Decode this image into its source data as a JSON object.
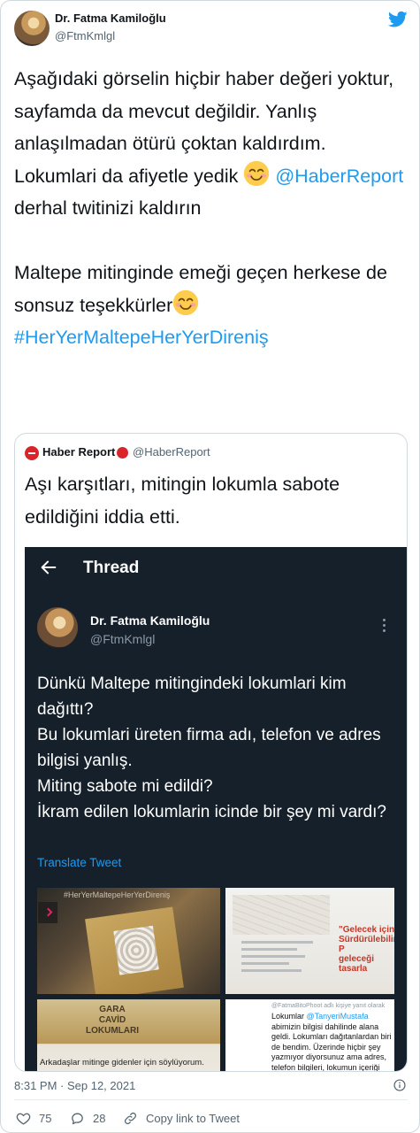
{
  "author": {
    "name": "Dr. Fatma Kamiloğlu",
    "handle": "@FtmKmlgl"
  },
  "tweet": {
    "text_part1": "Aşağıdaki görselin hiçbir haber değeri yoktur, sayfamda da mevcut değildir. Yanlış anlaşılmadan ötürü çoktan kaldırdım. Lokumlari da afiyetle yedik ",
    "mention": "@HaberReport",
    "text_part2": " derhal twitinizi kaldırın",
    "text_part3": "Maltepe mitinginde emeği geçen herkese de sonsuz teşekkürler",
    "hashtag": "#HerYerMaltepeHerYerDireniş"
  },
  "quote": {
    "name": "Haber Report",
    "handle": "@HaberReport",
    "text": "Aşı karşıtları, mitingin lokumla sabote edildiğini iddia etti."
  },
  "screenshot": {
    "title": "Thread",
    "author_name": "Dr. Fatma Kamiloğlu",
    "author_handle": "@FtmKmlgl",
    "text_lines": [
      "Dünkü Maltepe mitingindeki lokumlari kim dağıttı?",
      "Bu lokumlari üreten firma adı, telefon ve adres bilgisi yanlış.",
      "Miting sabote mi edildi?",
      "İkram edilen lokumlarin icinde bir şey mi vardı?"
    ],
    "translate": "Translate Tweet",
    "img1_hashtag": "#HerYerMaltepeHerYerDireniş",
    "img2_red_text": [
      "\"Gelecek için",
      "Sürdürülebilir P",
      "geleceği tasarla"
    ],
    "img3_label": [
      "GARA",
      "CAVİD",
      "LOKUMLARI"
    ],
    "img3_caption": "Arkadaşlar mitinge gidenler için söylüyorum.",
    "img4_head": "@FatmaBitoPhoot adlı kişiye yanıt olarak",
    "img4_text_a": "Lokumlar ",
    "img4_mention": "@TanyeriMustafa",
    "img4_text_b": " abimizin bilgisi dahilinde alana geldi. Lokumları dağıtanlardan biri de bendim. Üzerinde hiçbir şey yazmıyor diyorsunuz ama adres, telefon bilgileri, lokumun içeriği"
  },
  "footer": {
    "timestamp": "8:31 PM · Sep 12, 2021",
    "likes": "75",
    "replies": "28",
    "copy_link": "Copy link to Tweet"
  },
  "colors": {
    "link": "#1d9bf0",
    "muted": "#536471",
    "dark_bg": "#15202b",
    "brand_red": "#d9252a"
  },
  "icons": [
    "twitter-logo-icon",
    "smile-emoji-icon",
    "back-arrow-icon",
    "more-icon",
    "info-icon",
    "heart-icon",
    "reply-icon",
    "link-icon",
    "chevron-right-icon"
  ]
}
